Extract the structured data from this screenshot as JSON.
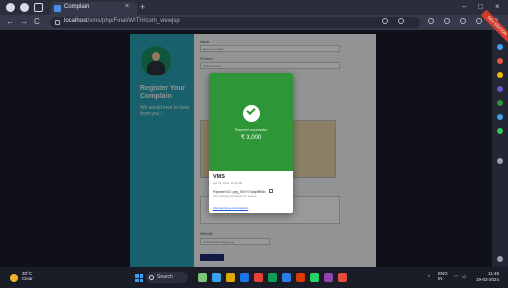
{
  "browser": {
    "tab_title": "Complain",
    "tab_close": "×",
    "new_tab": "+",
    "url_host": "localhost",
    "url_path": "/vms/php/Final/WITH/com_viewjsp",
    "win_min": "–",
    "win_max": "□",
    "win_close": "×",
    "nav_back": "←",
    "nav_forward": "→",
    "nav_reload": "C"
  },
  "left_panel": {
    "title": "Register Your Complain",
    "subtitle": "We would love to hear from you !"
  },
  "form": {
    "field1_label": "Name",
    "field1_placeholder": "Enter a product",
    "field2_label": "Problem",
    "field2_value": "VMS Member",
    "file_button": "Choose File",
    "file_name": "Image.png",
    "submit_label": "Submit",
    "website_label": "Website"
  },
  "modal": {
    "status_text": "Payment successful",
    "amount": "₹ 3,000",
    "merchant": "VMS",
    "merchant_sub": "Apr 19, 2024, 11:49 AM",
    "payment_id": "Payment ID: pay_NXYV7a6p9ifh8x",
    "payment_id_sub": "Visit razorpay.com/support for queries",
    "link": "Visit razorpay.com/support"
  },
  "sidebar": {
    "ribbon": "DEV EDITION"
  },
  "taskbar": {
    "weather_temp": "30°C",
    "weather_desc": "Clear",
    "search_label": "Search",
    "tray_lang": "ENG",
    "tray_region": "IN",
    "clock_time": "11:49",
    "clock_date": "19-03-2024"
  },
  "colors": {
    "modal_green": "#2e9636",
    "left_panel": "#29a1b3",
    "submit": "#1e2a6e"
  }
}
